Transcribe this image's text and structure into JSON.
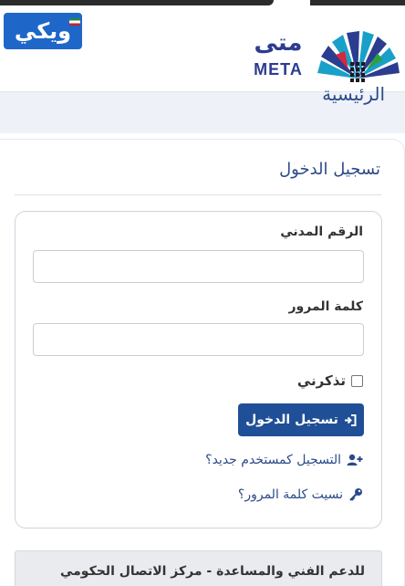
{
  "header": {
    "wiki_badge": "ويكي",
    "logo_ar": "متى",
    "logo_en": "META"
  },
  "breadcrumb": {
    "home": "الرئيسية"
  },
  "login_card": {
    "title": "تسجيل الدخول",
    "civil_id_label": "الرقم المدني",
    "civil_id_value": "",
    "password_label": "كلمة المرور",
    "password_value": "",
    "remember_label": "تذكرني",
    "remember_checked": false,
    "login_button": "تسجيل الدخول",
    "register_link": "التسجيل كمستخدم جديد؟",
    "forgot_link": "نسيت كلمة المرور؟"
  },
  "support": {
    "text": "للدعم الفني والمساعدة - مركز الاتصال الحكومي"
  },
  "colors": {
    "primary": "#1f4f96",
    "link": "#2c4a8a",
    "badge": "#1f66c9",
    "logo_navy": "#2c3d8f",
    "logo_teal": "#19a0c8",
    "logo_red": "#d6283b",
    "logo_green": "#2e9e4a"
  },
  "icons": {
    "login": "sign-in-icon",
    "register": "user-plus-icon",
    "forgot": "key-icon"
  }
}
